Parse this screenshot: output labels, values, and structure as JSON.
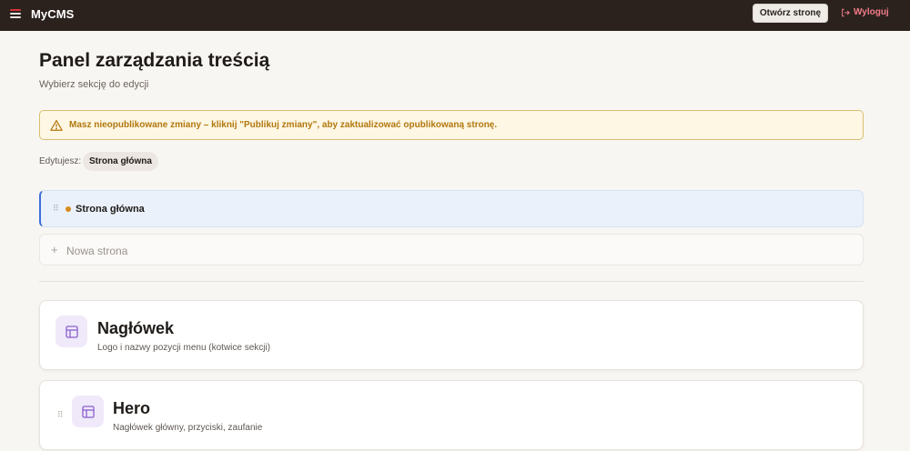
{
  "header": {
    "brand": "MyCMS",
    "open_site_label": "Otwórz stronę",
    "logout_label": "Wyloguj",
    "menu_icon": "hamburger-menu-icon",
    "logout_icon": "logout-icon"
  },
  "main": {
    "title": "Panel zarządzania treścią",
    "subtitle": "Wybierz sekcję do edycji"
  },
  "warning": {
    "icon": "warning-triangle-icon",
    "text": "Masz nieopublikowane zmiany – kliknij \"Publikuj zmiany\", aby zaktualizować opublikowaną stronę.",
    "color": "#b2770d"
  },
  "editing": {
    "label": "Edytujesz:",
    "current_page": "Strona główna"
  },
  "pages": {
    "items": [
      {
        "name": "Strona główna",
        "status_color": "#d9891f",
        "selected": true
      }
    ],
    "new_page_label": "Nowa strona"
  },
  "sections": [
    {
      "title": "Nagłówek",
      "description": "Logo i nazwy pozycji menu (kotwice sekcji)",
      "icon": "layout-icon"
    },
    {
      "title": "Hero",
      "description": "Nagłówek główny, przyciski, zaufanie",
      "icon": "layout-icon"
    }
  ],
  "colors": {
    "topbar": "#2c221d",
    "accent_blue": "#3d6fd8",
    "logout": "#f27b8a",
    "icon_purple": "#8b5fcf"
  }
}
